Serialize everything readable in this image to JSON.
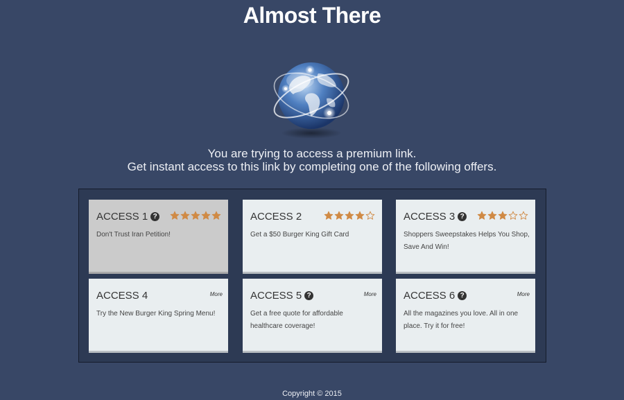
{
  "page": {
    "title": "Almost There",
    "intro_line1": "You are trying to access a premium link.",
    "intro_line2": "Get instant access to this link by completing one of the following offers.",
    "footer": "Copyright © 2015"
  },
  "offers": [
    {
      "title": "ACCESS 1",
      "help": true,
      "rating": 5,
      "more": "",
      "desc": "Don't Trust Iran Petition!",
      "active": true
    },
    {
      "title": "ACCESS 2",
      "help": false,
      "rating": 4,
      "more": "",
      "desc": "Get a $50 Burger King Gift Card",
      "active": false
    },
    {
      "title": "ACCESS 3",
      "help": true,
      "rating": 3,
      "more": "",
      "desc": "Shoppers Sweepstakes Helps You Shop, Save And Win!",
      "active": false
    },
    {
      "title": "ACCESS 4",
      "help": false,
      "rating": 0,
      "more": "More",
      "desc": "Try the New Burger King Spring Menu!",
      "active": false
    },
    {
      "title": "ACCESS 5",
      "help": true,
      "rating": 0,
      "more": "More",
      "desc": "Get a free quote for affordable healthcare coverage!",
      "active": false
    },
    {
      "title": "ACCESS 6",
      "help": true,
      "rating": 0,
      "more": "More",
      "desc": "All the magazines you love. All in one place. Try it for free!",
      "active": false
    }
  ],
  "colors": {
    "background": "#384766",
    "panel": "#2d3a54",
    "star": "#d08a45",
    "card": "#e9eef0",
    "card_active": "#cbcbcb"
  },
  "icons": {
    "globe": "globe-icon",
    "help": "question-circle-icon",
    "star": "star-icon"
  }
}
